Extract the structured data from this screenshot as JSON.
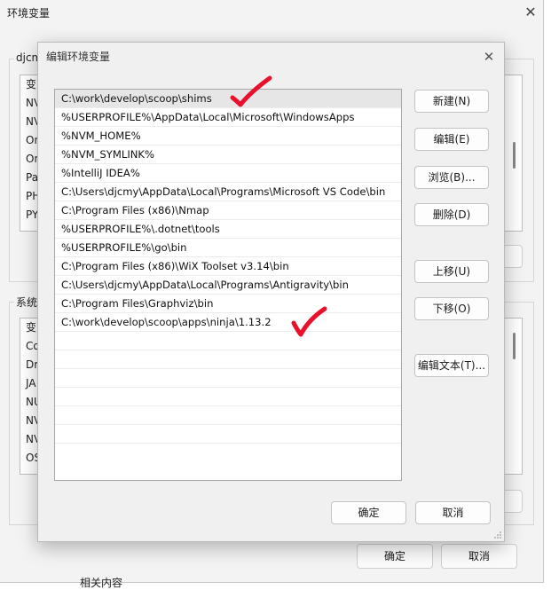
{
  "background_window": {
    "title": "环境变量",
    "user_group_label": "djcm",
    "user_list": [
      "变",
      "NV",
      "NV",
      "On",
      "On",
      "Pa",
      "PH",
      "PY"
    ],
    "system_group_label": "系统",
    "system_list": [
      "变",
      "Co",
      "Dr",
      "JA",
      "NU",
      "NV",
      "NV",
      "OS"
    ],
    "ok_label": "确定",
    "cancel_label": "取消",
    "underneath_text": "相关内容"
  },
  "dialog": {
    "title": "编辑环境变量",
    "paths": [
      "C:\\work\\develop\\scoop\\shims",
      "%USERPROFILE%\\AppData\\Local\\Microsoft\\WindowsApps",
      "%NVM_HOME%",
      "%NVM_SYMLINK%",
      "%IntelliJ IDEA%",
      "C:\\Users\\djcmy\\AppData\\Local\\Programs\\Microsoft VS Code\\bin",
      "C:\\Program Files (x86)\\Nmap",
      "%USERPROFILE%\\.dotnet\\tools",
      "%USERPROFILE%\\go\\bin",
      "C:\\Program Files (x86)\\WiX Toolset v3.14\\bin",
      "C:\\Users\\djcmy\\AppData\\Local\\Programs\\Antigravity\\bin",
      "C:\\Program Files\\Graphviz\\bin",
      "C:\\work\\develop\\scoop\\apps\\ninja\\1.13.2"
    ],
    "buttons": {
      "new": "新建(N)",
      "edit": "编辑(E)",
      "browse": "浏览(B)...",
      "delete": "删除(D)",
      "move_up": "上移(U)",
      "move_down": "下移(O)",
      "edit_text": "编辑文本(T)..."
    },
    "ok_label": "确定",
    "cancel_label": "取消"
  },
  "annotation_color": "#e8102a"
}
